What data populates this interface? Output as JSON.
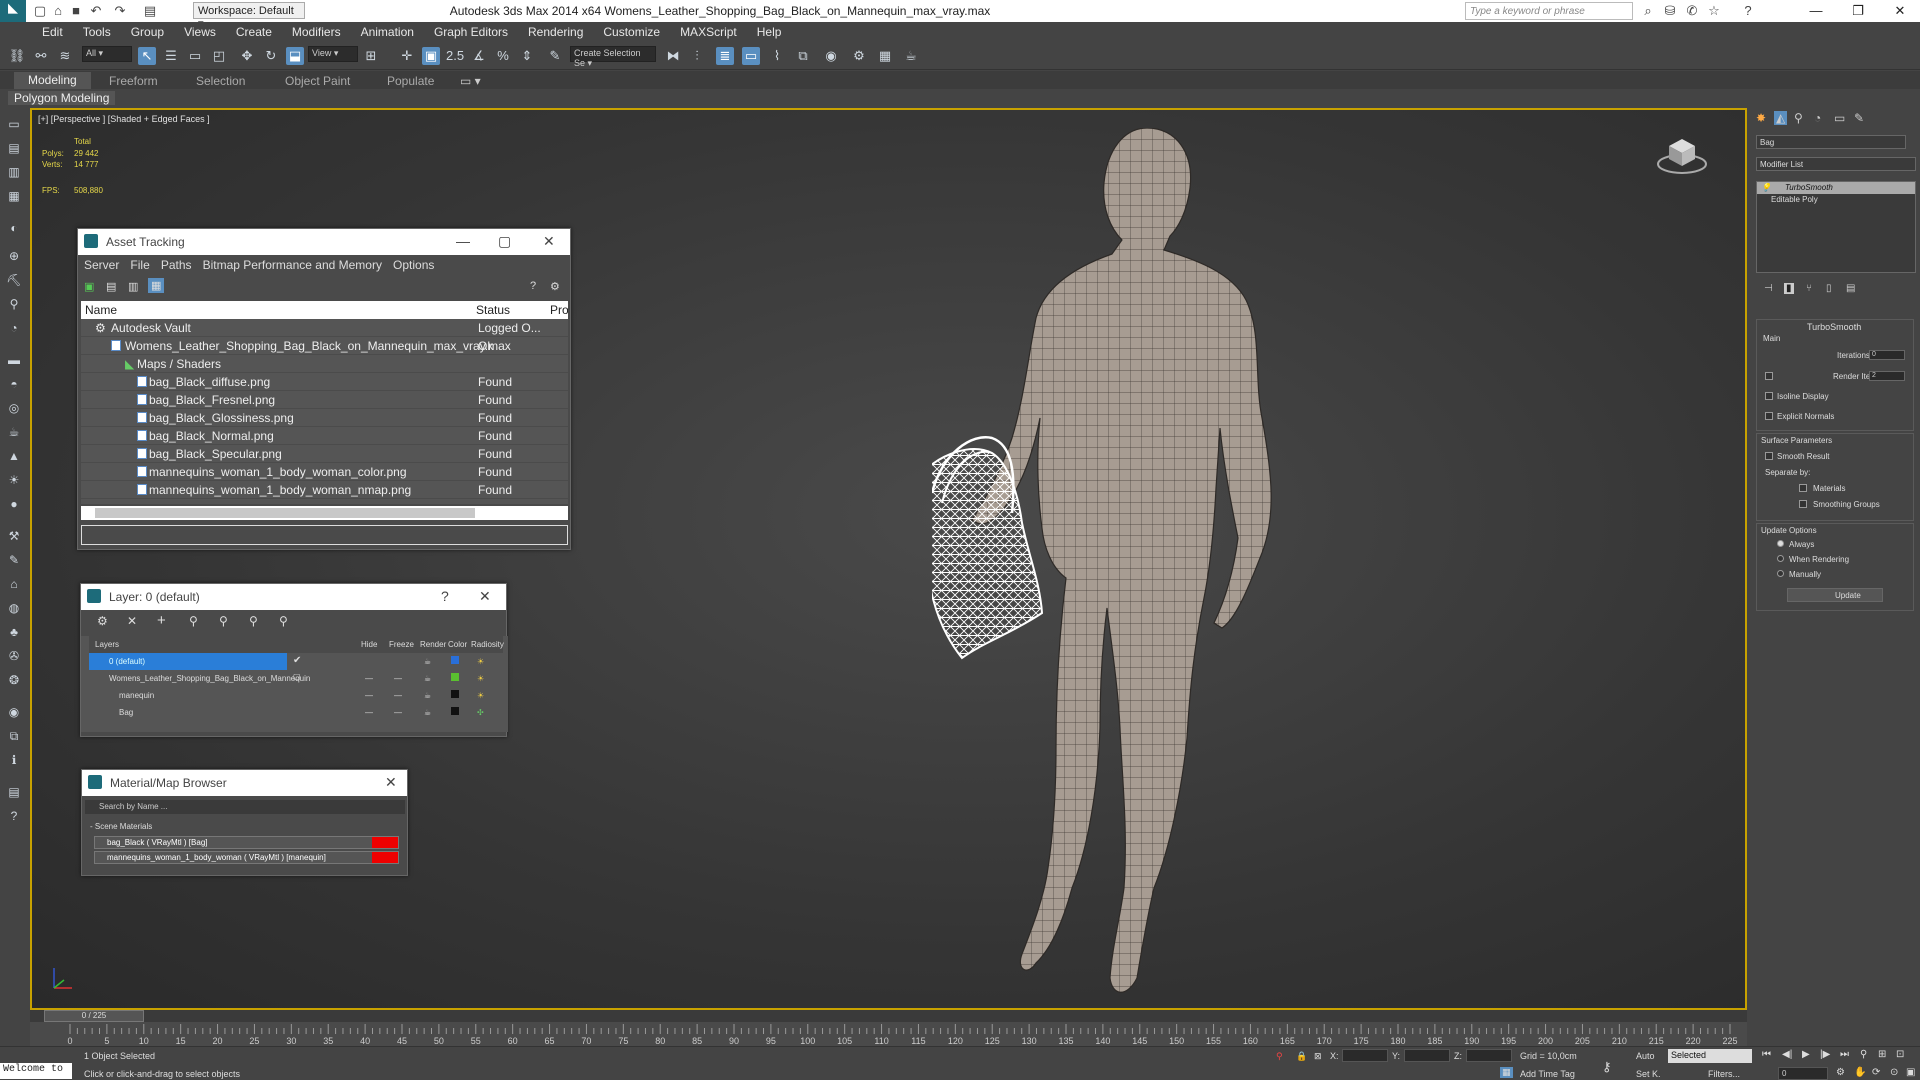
{
  "app": {
    "title": "Autodesk 3ds Max  2014 x64    Womens_Leather_Shopping_Bag_Black_on_Mannequin_max_vray.max",
    "workspace": "Workspace: Default",
    "search_placeholder": "Type a keyword or phrase"
  },
  "menu": [
    "Edit",
    "Tools",
    "Group",
    "Views",
    "Create",
    "Modifiers",
    "Animation",
    "Graph Editors",
    "Rendering",
    "Customize",
    "MAXScript",
    "Help"
  ],
  "toolbar": {
    "selection_filter": "All",
    "ref_coord": "View",
    "named_selection": "Create Selection Se"
  },
  "ribbon": {
    "tabs": [
      "Modeling",
      "Freeform",
      "Selection",
      "Object Paint",
      "Populate"
    ],
    "sub": "Polygon Modeling"
  },
  "viewport": {
    "label": "[+] [Perspective ] [Shaded + Edged Faces ]",
    "stats_total": "Total",
    "polys_label": "Polys:",
    "polys_value": "29 442",
    "verts_label": "Verts:",
    "verts_value": "14 777",
    "fps_label": "FPS:",
    "fps_value": "508,880"
  },
  "asset_tracking": {
    "title": "Asset Tracking",
    "menu": [
      "Server",
      "File",
      "Paths",
      "Bitmap Performance and Memory",
      "Options"
    ],
    "columns": [
      "Name",
      "Status",
      "Pro"
    ],
    "rows": [
      {
        "name": "Autodesk Vault",
        "status": "Logged O..."
      },
      {
        "name": "Womens_Leather_Shopping_Bag_Black_on_Mannequin_max_vray.max",
        "status": "Ok"
      },
      {
        "name": "Maps / Shaders",
        "status": ""
      },
      {
        "name": "bag_Black_diffuse.png",
        "status": "Found"
      },
      {
        "name": "bag_Black_Fresnel.png",
        "status": "Found"
      },
      {
        "name": "bag_Black_Glossiness.png",
        "status": "Found"
      },
      {
        "name": "bag_Black_Normal.png",
        "status": "Found"
      },
      {
        "name": "bag_Black_Specular.png",
        "status": "Found"
      },
      {
        "name": "mannequins_woman_1_body_woman_color.png",
        "status": "Found"
      },
      {
        "name": "mannequins_woman_1_body_woman_nmap.png",
        "status": "Found"
      }
    ]
  },
  "layer": {
    "title": "Layer: 0 (default)",
    "help": "?",
    "columns": [
      "Layers",
      "Hide",
      "Freeze",
      "Render",
      "Color",
      "Radiosity"
    ],
    "rows": [
      {
        "name": "0 (default)",
        "hide": "",
        "freeze": "",
        "color": "#2a6fd8"
      },
      {
        "name": "Womens_Leather_Shopping_Bag_Black_on_Mannequin",
        "hide": "—",
        "freeze": "—",
        "color": "#5ac030"
      },
      {
        "name": "manequin",
        "hide": "—",
        "freeze": "—",
        "color": "#111111"
      },
      {
        "name": "Bag",
        "hide": "—",
        "freeze": "—",
        "color": "#111111"
      }
    ]
  },
  "material_browser": {
    "title": "Material/Map Browser",
    "search_placeholder": "Search by Name ...",
    "group": "- Scene Materials",
    "items": [
      "bag_Black  ( VRayMtl )  [Bag]",
      "mannequins_woman_1_body_woman  ( VRayMtl )  [manequin]"
    ]
  },
  "command_panel": {
    "object_name": "Bag",
    "modifier_list": "Modifier List",
    "stack": [
      "TurboSmooth",
      "Editable Poly"
    ],
    "rollout_title": "TurboSmooth",
    "main_label": "Main",
    "iterations_label": "Iterations:",
    "iterations_value": "0",
    "render_iters_label": "Render Iters:",
    "render_iters_value": "2",
    "isoline": "Isoline Display",
    "explicit_normals": "Explicit Normals",
    "surface_params": "Surface Parameters",
    "smooth_result": "Smooth Result",
    "separate_by": "Separate by:",
    "materials": "Materials",
    "smoothing_groups": "Smoothing Groups",
    "update_options": "Update Options",
    "always": "Always",
    "when_rendering": "When Rendering",
    "manually": "Manually",
    "update_button": "Update"
  },
  "timeline": {
    "frame": "0 / 225",
    "ticks": [
      "0",
      "5",
      "10",
      "15",
      "20",
      "25",
      "30",
      "35",
      "40",
      "45",
      "50",
      "55",
      "60",
      "65",
      "70",
      "75",
      "80",
      "85",
      "90",
      "95",
      "100",
      "105",
      "110",
      "115",
      "120",
      "125",
      "130",
      "135",
      "140",
      "145",
      "150",
      "155",
      "160",
      "165",
      "170",
      "175",
      "180",
      "185",
      "190",
      "195",
      "200",
      "205",
      "210",
      "215",
      "220",
      "225"
    ]
  },
  "status": {
    "welcome": "Welcome to",
    "selected": "1 Object Selected",
    "hint": "Click or click-and-drag to select objects",
    "x_label": "X:",
    "y_label": "Y:",
    "z_label": "Z:",
    "grid": "Grid = 10,0cm",
    "add_time_tag": "Add Time Tag",
    "auto": "Auto",
    "selected_dropdown": "Selected",
    "set_k": "Set K.",
    "filters": "Filters...",
    "frame_value": "0"
  }
}
